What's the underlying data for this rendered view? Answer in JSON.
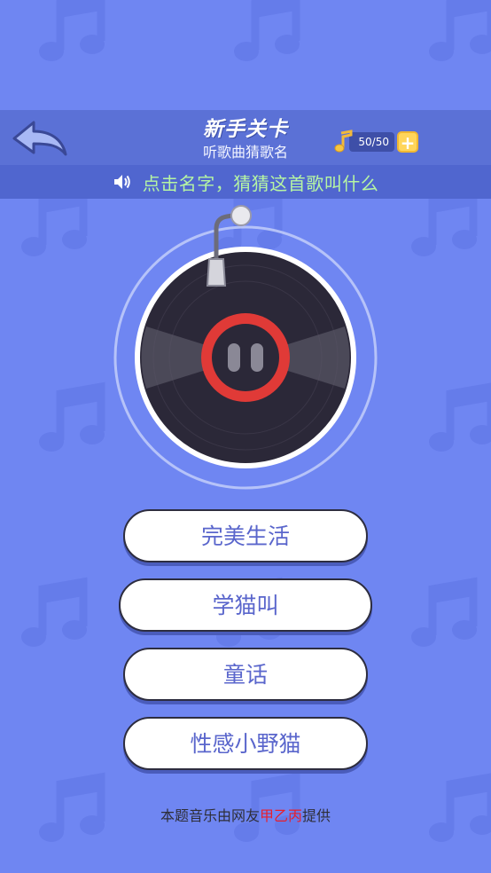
{
  "header": {
    "title": "新手关卡",
    "subtitle": "听歌曲猜歌名",
    "coins": "50/50",
    "plus": "+"
  },
  "hint": {
    "text": "点击名字，猜猜这首歌叫什么"
  },
  "answers": [
    "完美生活",
    "学猫叫",
    "童话",
    "性感小野猫"
  ],
  "footer": {
    "prefix": "本题音乐由网友",
    "name": "甲乙丙",
    "suffix": "提供"
  },
  "colors": {
    "background": "#6f86f2",
    "header": "#5b71d6",
    "hint_text": "#b6f5a3",
    "record_red": "#e03a37",
    "footer_name": "#e81f2c"
  },
  "icons": [
    "back-arrow-icon",
    "music-note-icon",
    "plus-icon",
    "speaker-icon",
    "pause-icon"
  ]
}
